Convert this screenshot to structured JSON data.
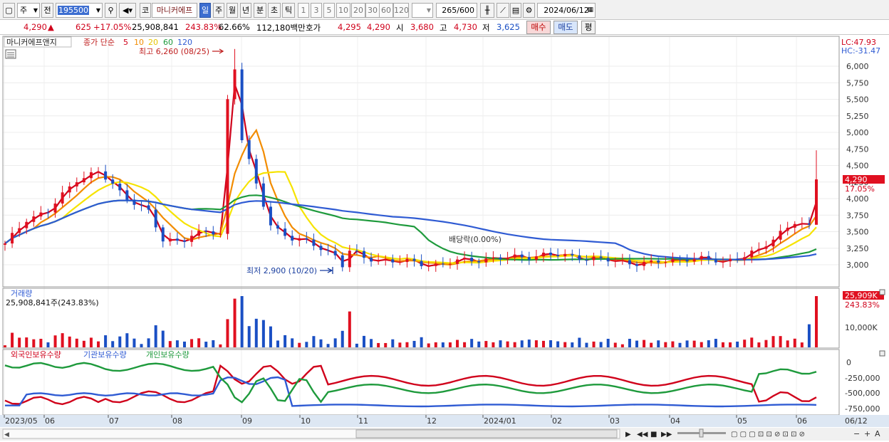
{
  "toolbar": {
    "market": "주",
    "period_prev": "전",
    "code": "195500",
    "name": "마니커에프",
    "tf_day": "일",
    "tf_week": "주",
    "tf_month": "월",
    "tf_year": "년",
    "tf_min": "분",
    "tf_sec": "초",
    "tf_tick": "틱",
    "nums": [
      "1",
      "3",
      "5",
      "10",
      "20",
      "30",
      "60",
      "120"
    ],
    "count": "265",
    "count_total": "/600",
    "date": "2024/06/12"
  },
  "quote": {
    "price": "4,290",
    "arrow": "▲",
    "change": "625",
    "change_pct": "+17.05%",
    "volume": "25,908,841",
    "vol_ratio": "243.83%",
    "turnover": "62.66%",
    "amount": "112,180백만",
    "hoga_label": "호가",
    "ask": "4,295",
    "bid": "4,290",
    "open_label": "시",
    "open": "3,680",
    "high_label": "고",
    "high": "4,730",
    "low_label": "저",
    "low": "3,625",
    "buy_btn": "매수",
    "sell_btn": "매도",
    "eval_btn": "평"
  },
  "price_panel": {
    "title": "마니커에프앤지",
    "ma_label": "종가 단순",
    "ma_periods": [
      "5",
      "10",
      "20",
      "60",
      "120"
    ],
    "ma_colors": [
      "#d0021b",
      "#f28c00",
      "#f6e300",
      "#1e9a3c",
      "#2f5bd3"
    ],
    "high_annot": "최고 6,260 (08/25)",
    "low_annot": "최저 2,900 (10/20)",
    "div_annot": "배당락(0.00%)",
    "lc": "LC:47.93",
    "hc": "HC:-31.47",
    "last_price": "4,290",
    "last_pct": "17.05%",
    "y_ticks": [
      "6,000",
      "5,750",
      "5,500",
      "5,250",
      "5,000",
      "4,750",
      "4,500",
      "4,250",
      "4,000",
      "3,750",
      "3,500",
      "3,250",
      "3,000"
    ]
  },
  "volume_panel": {
    "title": "거래량",
    "info": "25,908,841주(243.83%)",
    "badge": "25,909K",
    "badge_pct": "243.83%",
    "tick": "10,000K"
  },
  "holdings_panel": {
    "titles": [
      "외국인보유수량",
      "기관보유수량",
      "개인보유수량"
    ],
    "colors": [
      "#d0021b",
      "#2f5bd3",
      "#1e9a3c"
    ],
    "ticks": [
      "0",
      "-250,000",
      "-500,000",
      "-750,000"
    ]
  },
  "x_axis": {
    "labels": [
      "2023/05",
      "06",
      "07",
      "08",
      "09",
      "10",
      "11",
      "12",
      "2024/01",
      "02",
      "03",
      "04",
      "05",
      "06"
    ],
    "right_label": "06/12"
  },
  "chart_data": {
    "type": "candlestick",
    "x_range": [
      "2023/05",
      "2024/06/12"
    ],
    "ylim": [
      2800,
      6260
    ],
    "price_points": [
      [
        0,
        3300
      ],
      [
        3,
        3700
      ],
      [
        6,
        3800
      ],
      [
        10,
        4300
      ],
      [
        13,
        4400
      ],
      [
        16,
        4100
      ],
      [
        20,
        3800
      ],
      [
        22,
        3350
      ],
      [
        25,
        3400
      ],
      [
        28,
        3500
      ],
      [
        30,
        3450
      ],
      [
        31,
        5500
      ],
      [
        32,
        6000
      ],
      [
        33,
        4900
      ],
      [
        35,
        4200
      ],
      [
        37,
        3600
      ],
      [
        40,
        3400
      ],
      [
        43,
        3300
      ],
      [
        46,
        3150
      ],
      [
        47,
        3000
      ],
      [
        48,
        3200
      ],
      [
        50,
        3100
      ],
      [
        55,
        3050
      ],
      [
        60,
        3000
      ],
      [
        65,
        3080
      ],
      [
        70,
        3100
      ],
      [
        75,
        3150
      ],
      [
        80,
        3120
      ],
      [
        85,
        3050
      ],
      [
        90,
        3020
      ],
      [
        95,
        3100
      ],
      [
        100,
        3050
      ],
      [
        105,
        3200
      ],
      [
        108,
        3500
      ],
      [
        110,
        3650
      ],
      [
        112,
        3550
      ],
      [
        113,
        4290
      ]
    ],
    "events": [
      {
        "label": "최고 6,260 (08/25)",
        "value": 6260
      },
      {
        "label": "최저 2,900 (10/20)",
        "value": 2900
      },
      {
        "label": "배당락(0.00%)"
      }
    ],
    "last_close": 4290,
    "last_volume": 25908841,
    "holding_range": [
      -750000,
      0
    ]
  }
}
